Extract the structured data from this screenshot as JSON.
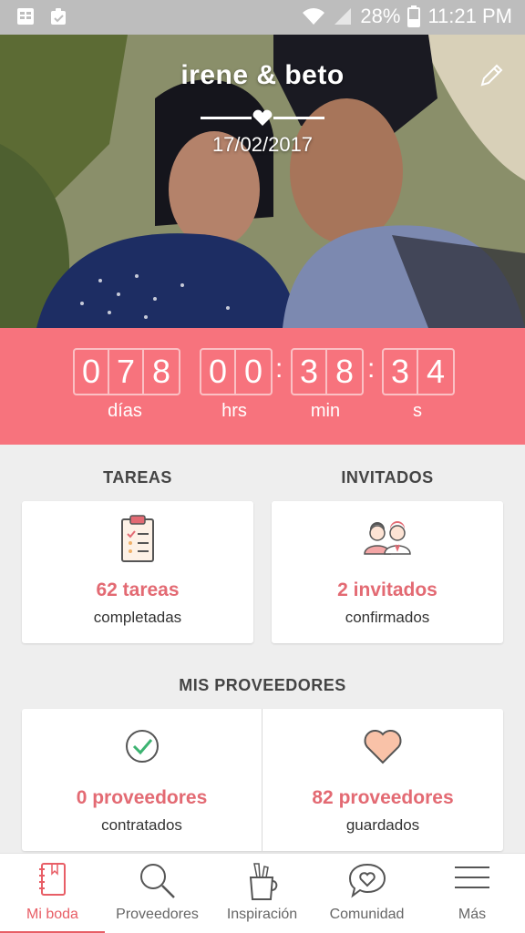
{
  "status_bar": {
    "battery": "28%",
    "time": "11:21 PM",
    "icons": [
      "sheets-icon",
      "clipboard-icon",
      "wifi-icon",
      "signal-icon",
      "battery-icon"
    ]
  },
  "hero": {
    "couple": "irene & beto",
    "date": "17/02/2017",
    "edit_icon": "pencil-icon"
  },
  "countdown": {
    "days": [
      "0",
      "7",
      "8"
    ],
    "hours": [
      "0",
      "0"
    ],
    "minutes": [
      "3",
      "8"
    ],
    "seconds": [
      "3",
      "4"
    ],
    "labels": {
      "days": "días",
      "hours": "hrs",
      "minutes": "min",
      "seconds": "s"
    }
  },
  "tasks": {
    "title": "TAREAS",
    "value": "62 tareas",
    "sub": "completadas",
    "icon": "clipboard-checklist-icon"
  },
  "guests": {
    "title": "INVITADOS",
    "value": "2 invitados",
    "sub": "confirmados",
    "icon": "guests-couple-icon"
  },
  "vendors": {
    "title": "MIS PROVEEDORES",
    "hired": {
      "value": "0 proveedores",
      "sub": "contratados",
      "icon": "check-circle-icon"
    },
    "saved": {
      "value": "82 proveedores",
      "sub": "guardados",
      "icon": "heart-icon"
    }
  },
  "nav": [
    {
      "label": "Mi boda",
      "icon": "notebook-icon",
      "active": true
    },
    {
      "label": "Proveedores",
      "icon": "search-icon",
      "active": false
    },
    {
      "label": "Inspiración",
      "icon": "pencil-cup-icon",
      "active": false
    },
    {
      "label": "Comunidad",
      "icon": "chat-heart-icon",
      "active": false
    },
    {
      "label": "Más",
      "icon": "menu-icon",
      "active": false
    }
  ],
  "colors": {
    "accent": "#f7737d",
    "accent_text": "#e36a73",
    "active_nav": "#e85e66",
    "status_bar": "#bdbdbd",
    "background": "#eeeeee"
  }
}
